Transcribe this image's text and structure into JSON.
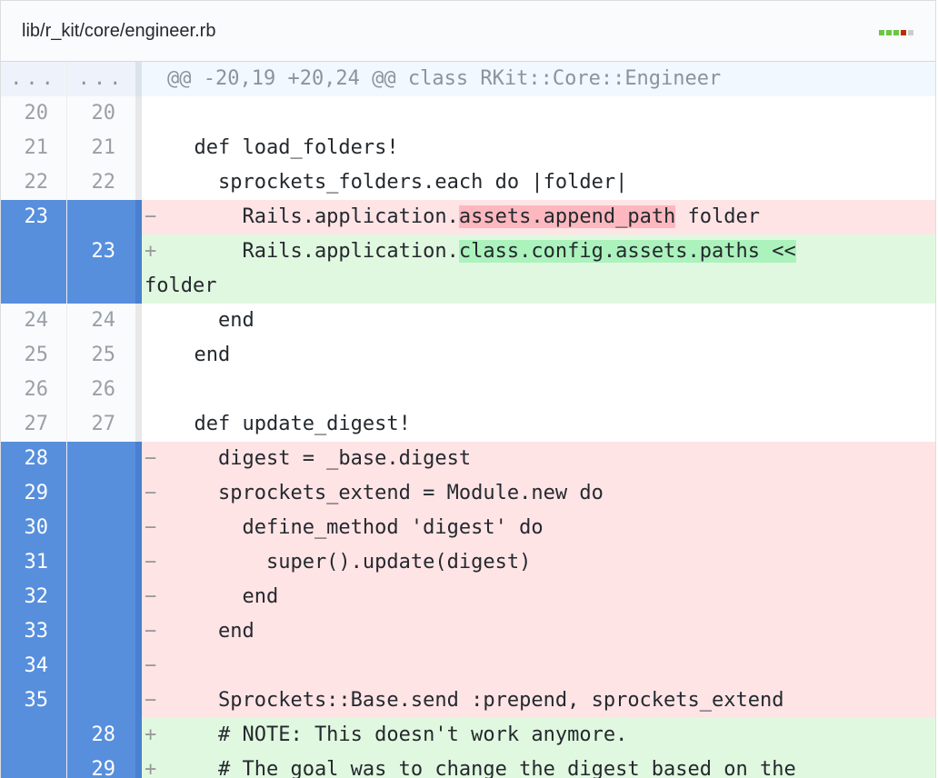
{
  "file": {
    "path": "lib/r_kit/core/engineer.rb",
    "diffstat_colors": [
      "#6cc644",
      "#6cc644",
      "#6cc644",
      "#bd2c00",
      "#cccccc"
    ]
  },
  "hunk": {
    "left": "...",
    "right": "...",
    "text": "@@ -20,19 +20,24 @@ class RKit::Core::Engineer"
  },
  "lines": [
    {
      "old": "20",
      "new": "20",
      "marker": " ",
      "text": ""
    },
    {
      "old": "21",
      "new": "21",
      "marker": " ",
      "text": "  def load_folders!"
    },
    {
      "old": "22",
      "new": "22",
      "marker": " ",
      "text": "    sprockets_folders.each do |folder|"
    },
    {
      "old": "23",
      "new": "",
      "marker": "−",
      "pre": "      Rails.application.",
      "hl": "assets.append_path",
      "post": " folder"
    },
    {
      "old": "",
      "new": "23",
      "marker": "+",
      "pre": "      Rails.application.",
      "hl": "class.config.assets.paths <<",
      "post": "",
      "wrap": "folder"
    },
    {
      "old": "24",
      "new": "24",
      "marker": " ",
      "text": "    end"
    },
    {
      "old": "25",
      "new": "25",
      "marker": " ",
      "text": "  end"
    },
    {
      "old": "26",
      "new": "26",
      "marker": " ",
      "text": ""
    },
    {
      "old": "27",
      "new": "27",
      "marker": " ",
      "text": "  def update_digest!"
    },
    {
      "old": "28",
      "new": "",
      "marker": "−",
      "text": "    digest = _base.digest"
    },
    {
      "old": "29",
      "new": "",
      "marker": "−",
      "text": "    sprockets_extend = Module.new do"
    },
    {
      "old": "30",
      "new": "",
      "marker": "−",
      "text": "      define_method 'digest' do"
    },
    {
      "old": "31",
      "new": "",
      "marker": "−",
      "text": "        super().update(digest)"
    },
    {
      "old": "32",
      "new": "",
      "marker": "−",
      "text": "      end"
    },
    {
      "old": "33",
      "new": "",
      "marker": "−",
      "text": "    end"
    },
    {
      "old": "34",
      "new": "",
      "marker": "−",
      "text": ""
    },
    {
      "old": "35",
      "new": "",
      "marker": "−",
      "text": "    Sprockets::Base.send :prepend, sprockets_extend"
    },
    {
      "old": "",
      "new": "28",
      "marker": "+",
      "text": "    # NOTE: This doesn't work anymore."
    },
    {
      "old": "",
      "new": "29",
      "marker": "+",
      "text": "    # The goal was to change the digest based on the"
    }
  ]
}
